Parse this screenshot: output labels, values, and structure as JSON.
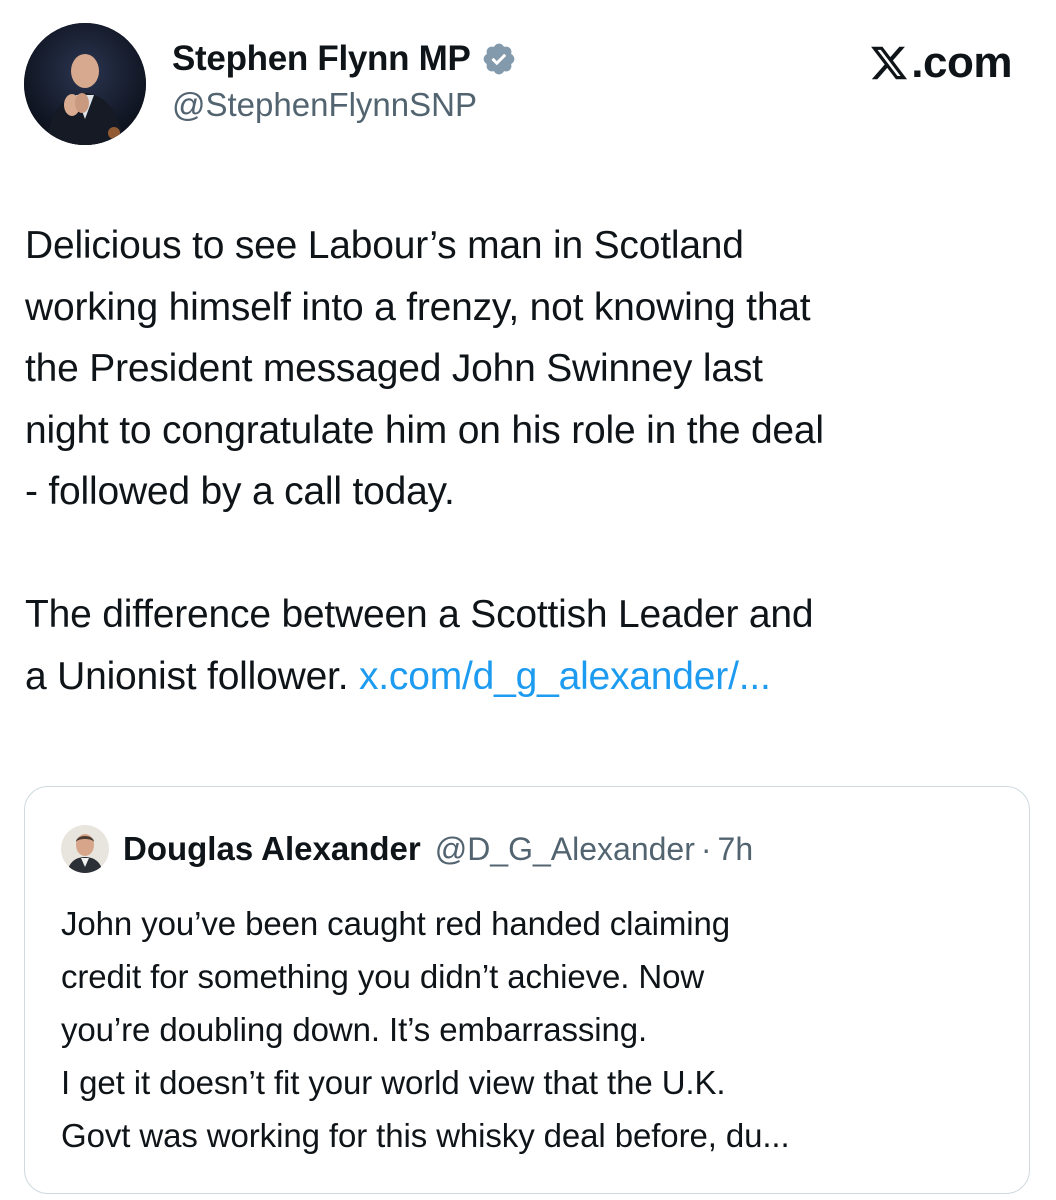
{
  "post": {
    "author": {
      "display_name": "Stephen Flynn MP",
      "handle": "@StephenFlynnSNP",
      "verified": true,
      "avatar_icon": "profile-photo-avatar",
      "verified_icon": "verified-badge-icon"
    },
    "site_brand": {
      "logo_icon": "x-logo-icon",
      "text": ".com"
    },
    "body": {
      "paragraph_1": "Delicious to see Labour’s man in Scotland\nworking himself into a frenzy, not knowing that\nthe President messaged John Swinney last\nnight to congratulate him on his role in the deal\n- followed by a call today.",
      "paragraph_2_text": "The difference between a Scottish Leader and\na Unionist follower. ",
      "link_text": "x.com/d_g_alexander/..."
    },
    "quoted_post": {
      "author": "Douglas Alexander",
      "handle": "@D_G_Alexander",
      "separator": "·",
      "time": "7h",
      "avatar_icon": "profile-photo-avatar",
      "text": "John you’ve been caught red handed claiming\ncredit for something you didn’t achieve. Now\nyou’re doubling down. It’s embarrassing.\nI get it doesn’t fit your world view that the U.K.\nGovt was working for this whisky deal before, du..."
    }
  },
  "colors": {
    "text_primary": "#0f1419",
    "text_secondary": "#536471",
    "link": "#1d9bf0",
    "border": "#cfd9de",
    "verified_badge": "#829aab"
  }
}
